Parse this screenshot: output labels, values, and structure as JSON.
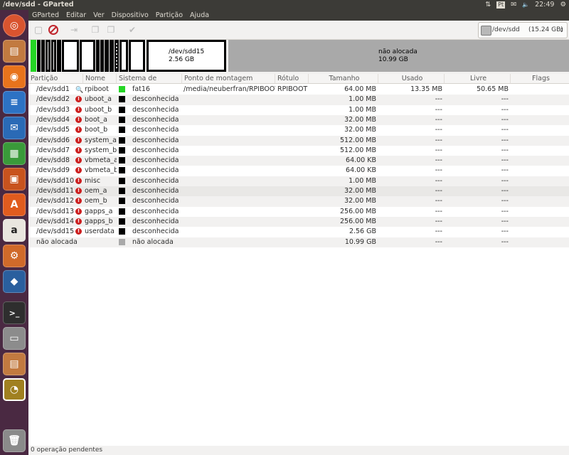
{
  "window": {
    "title": "/dev/sdd - GParted"
  },
  "tray": {
    "network": "⇅",
    "keyboard": "Pt",
    "mail": "✉",
    "volume": "🔈",
    "clock": "22:49",
    "power": "⚙"
  },
  "menu": [
    "GParted",
    "Editar",
    "Ver",
    "Dispositivo",
    "Partição",
    "Ajuda"
  ],
  "device_selector": {
    "device": "/dev/sdd",
    "size": "(15.24 GB)"
  },
  "map": {
    "sdd15": {
      "name": "/dev/sdd15",
      "size": "2.56 GB"
    },
    "unallocated": {
      "name": "não alocada",
      "size": "10.99 GB"
    }
  },
  "columns": [
    "Partição",
    "Nome",
    "Sistema de arquivos",
    "Ponto de montagem",
    "Rótulo",
    "Tamanho",
    "Usado",
    "Livre",
    "Flags"
  ],
  "rows": [
    {
      "partition": "/dev/sdd1",
      "name": "rpiboot",
      "fs": "fat16",
      "fs_color": "#24d624",
      "mount": "/media/neuberfran/RPIBOOT",
      "label": "RPIBOOT",
      "size": "64.00 MB",
      "used": "13.35 MB",
      "free": "50.65 MB",
      "flags": "",
      "icon": "magnifier"
    },
    {
      "partition": "/dev/sdd2",
      "name": "uboot_a",
      "fs": "desconhecida",
      "fs_color": "#000000",
      "mount": "",
      "label": "",
      "size": "1.00 MB",
      "used": "---",
      "free": "---",
      "flags": "",
      "icon": "warning"
    },
    {
      "partition": "/dev/sdd3",
      "name": "uboot_b",
      "fs": "desconhecida",
      "fs_color": "#000000",
      "mount": "",
      "label": "",
      "size": "1.00 MB",
      "used": "---",
      "free": "---",
      "flags": "",
      "icon": "warning"
    },
    {
      "partition": "/dev/sdd4",
      "name": "boot_a",
      "fs": "desconhecida",
      "fs_color": "#000000",
      "mount": "",
      "label": "",
      "size": "32.00 MB",
      "used": "---",
      "free": "---",
      "flags": "",
      "icon": "warning"
    },
    {
      "partition": "/dev/sdd5",
      "name": "boot_b",
      "fs": "desconhecida",
      "fs_color": "#000000",
      "mount": "",
      "label": "",
      "size": "32.00 MB",
      "used": "---",
      "free": "---",
      "flags": "",
      "icon": "warning"
    },
    {
      "partition": "/dev/sdd6",
      "name": "system_a",
      "fs": "desconhecida",
      "fs_color": "#000000",
      "mount": "",
      "label": "",
      "size": "512.00 MB",
      "used": "---",
      "free": "---",
      "flags": "",
      "icon": "warning"
    },
    {
      "partition": "/dev/sdd7",
      "name": "system_b",
      "fs": "desconhecida",
      "fs_color": "#000000",
      "mount": "",
      "label": "",
      "size": "512.00 MB",
      "used": "---",
      "free": "---",
      "flags": "",
      "icon": "warning"
    },
    {
      "partition": "/dev/sdd8",
      "name": "vbmeta_a",
      "fs": "desconhecida",
      "fs_color": "#000000",
      "mount": "",
      "label": "",
      "size": "64.00 KB",
      "used": "---",
      "free": "---",
      "flags": "",
      "icon": "warning"
    },
    {
      "partition": "/dev/sdd9",
      "name": "vbmeta_b",
      "fs": "desconhecida",
      "fs_color": "#000000",
      "mount": "",
      "label": "",
      "size": "64.00 KB",
      "used": "---",
      "free": "---",
      "flags": "",
      "icon": "warning"
    },
    {
      "partition": "/dev/sdd10",
      "name": "misc",
      "fs": "desconhecida",
      "fs_color": "#000000",
      "mount": "",
      "label": "",
      "size": "1.00 MB",
      "used": "---",
      "free": "---",
      "flags": "",
      "icon": "warning"
    },
    {
      "partition": "/dev/sdd11",
      "name": "oem_a",
      "fs": "desconhecida",
      "fs_color": "#000000",
      "mount": "",
      "label": "",
      "size": "32.00 MB",
      "used": "---",
      "free": "---",
      "flags": "",
      "icon": "warning"
    },
    {
      "partition": "/dev/sdd12",
      "name": "oem_b",
      "fs": "desconhecida",
      "fs_color": "#000000",
      "mount": "",
      "label": "",
      "size": "32.00 MB",
      "used": "---",
      "free": "---",
      "flags": "",
      "icon": "warning"
    },
    {
      "partition": "/dev/sdd13",
      "name": "gapps_a",
      "fs": "desconhecida",
      "fs_color": "#000000",
      "mount": "",
      "label": "",
      "size": "256.00 MB",
      "used": "---",
      "free": "---",
      "flags": "",
      "icon": "warning"
    },
    {
      "partition": "/dev/sdd14",
      "name": "gapps_b",
      "fs": "desconhecida",
      "fs_color": "#000000",
      "mount": "",
      "label": "",
      "size": "256.00 MB",
      "used": "---",
      "free": "---",
      "flags": "",
      "icon": "warning"
    },
    {
      "partition": "/dev/sdd15",
      "name": "userdata",
      "fs": "desconhecida",
      "fs_color": "#000000",
      "mount": "",
      "label": "",
      "size": "2.56 GB",
      "used": "---",
      "free": "---",
      "flags": "",
      "icon": "warning"
    },
    {
      "partition": "não alocada",
      "name": "",
      "fs": "não alocada",
      "fs_color": "#a9a9a9",
      "mount": "",
      "label": "",
      "size": "10.99 GB",
      "used": "---",
      "free": "---",
      "flags": "",
      "icon": ""
    }
  ],
  "status": "0 operação pendentes",
  "launcher": [
    "ubuntu-dash",
    "files",
    "firefox",
    "writer",
    "thunderbird",
    "calc",
    "impress",
    "software-center",
    "amazon",
    "settings",
    "virtualbox",
    "terminal",
    "scanner",
    "files-2",
    "gparted",
    "trash"
  ]
}
